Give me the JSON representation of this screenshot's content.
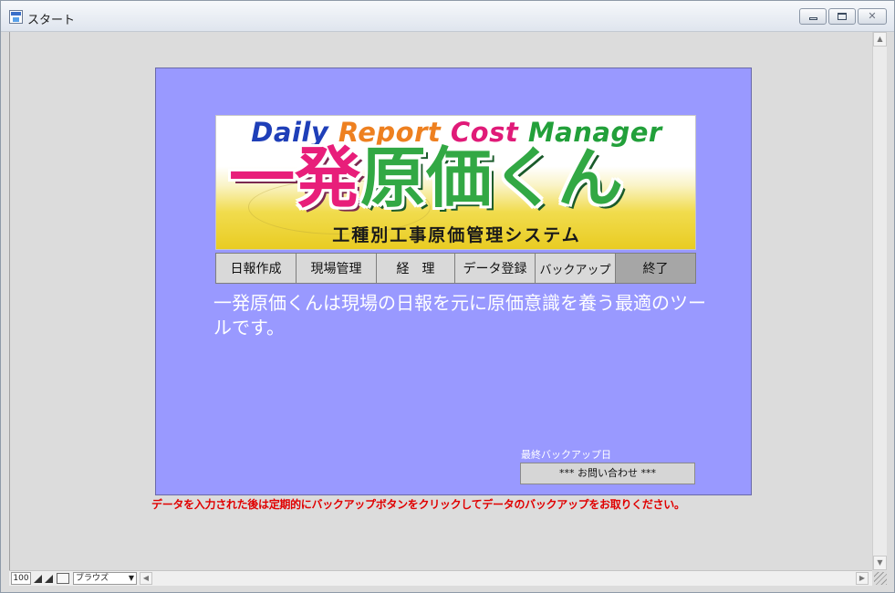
{
  "window": {
    "title": "スタート",
    "controls": {
      "minimize": "minimize",
      "maximize": "maximize",
      "close": "✕"
    }
  },
  "banner": {
    "title_en": {
      "daily": "Daily",
      "report": "Report",
      "cost": "Cost",
      "manager": "Manager"
    },
    "title_jp_pink": "一発",
    "title_jp_green": "原価くん",
    "subtitle": "工種別工事原価管理システム",
    "colors": {
      "daily": "#1f3fb8",
      "report": "#ee8020",
      "cost": "#e01a78",
      "manager": "#22a03a"
    }
  },
  "menu": {
    "items": [
      {
        "label": "日報作成"
      },
      {
        "label": "現場管理"
      },
      {
        "label": "経　理"
      },
      {
        "label": "データ登録"
      },
      {
        "label": "バックアップ"
      },
      {
        "label": "終了"
      }
    ]
  },
  "description": "一発原価くんは現場の日報を元に原価意識を養う最適のツールです。",
  "backup": {
    "label": "最終バックアップ日",
    "contact_button": "*** お問い合わせ ***"
  },
  "notice": "データを入力された後は定期的にバックアップボタンをクリックしてデータのバックアップをお取りください。",
  "statusbar": {
    "zoom": "100",
    "mode": "ブラウズ"
  },
  "colors": {
    "panel_bg": "#9999ff",
    "notice_text": "#e00000"
  }
}
